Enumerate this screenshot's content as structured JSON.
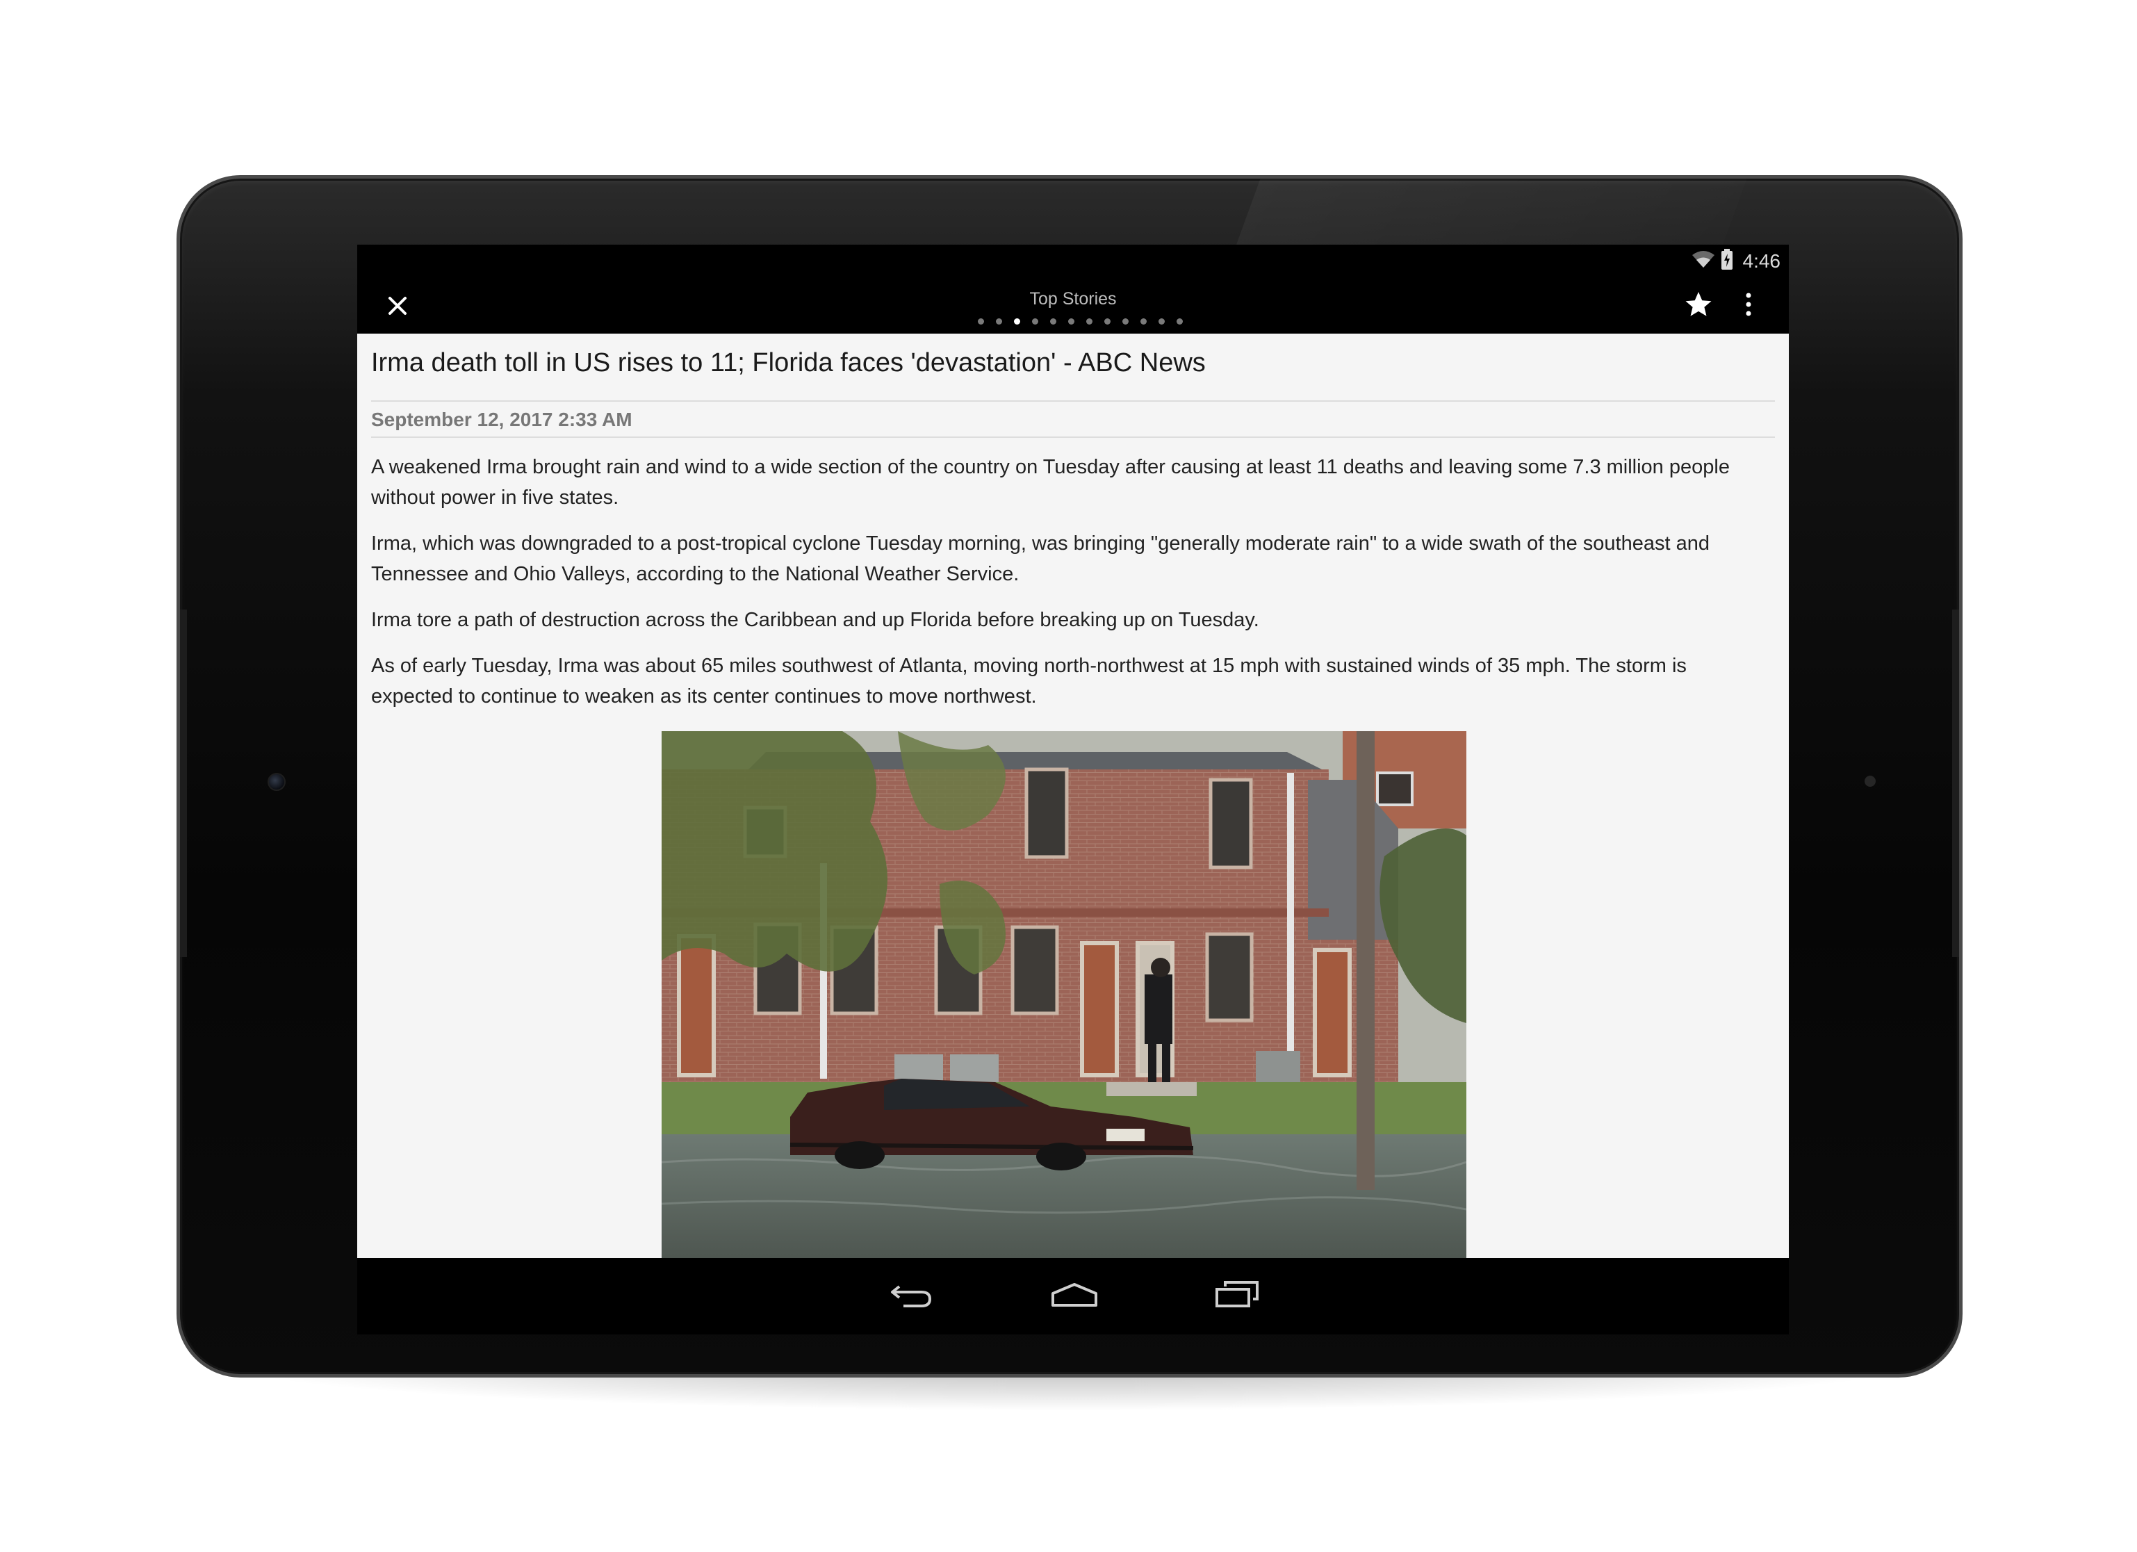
{
  "status_bar": {
    "time": "4:46",
    "icons": [
      "wifi-icon",
      "battery-icon"
    ]
  },
  "app_bar": {
    "close_icon": "close-icon",
    "title": "Top Stories",
    "page_count": 12,
    "active_page_index": 2,
    "star_icon": "star-icon",
    "menu_icon": "overflow-menu-icon"
  },
  "article": {
    "headline": "Irma death toll in US rises to 11; Florida faces 'devastation' - ABC News",
    "date": "September 12, 2017 2:33 AM",
    "paragraphs": [
      "A weakened Irma brought rain and wind to a wide section of the country on Tuesday after causing at least 11 deaths and leaving some 7.3 million people without power in five states.",
      "Irma, which was downgraded to a post-tropical cyclone Tuesday morning, was bringing \"generally moderate rain\" to a wide swath of the southeast and Tennessee and Ohio Valleys, according to the National Weather Service.",
      "Irma tore a path of destruction across the Caribbean and up Florida before breaking up on Tuesday.",
      "As of early Tuesday, Irma was about 65 miles southwest of Atlanta, moving north-northwest at 15 mph with sustained winds of 35 mph. The storm is expected to continue to weaken as its center continues to move northwest."
    ],
    "photo_icon": "flooded-street-photo"
  },
  "nav_bar": {
    "icons": [
      "back-icon",
      "home-icon",
      "recents-icon"
    ]
  },
  "colors": {
    "app_bar_bg": "#000000",
    "content_bg": "#f5f5f5",
    "headline": "#1a1a1a",
    "date": "#777777",
    "body_text": "#222222"
  }
}
